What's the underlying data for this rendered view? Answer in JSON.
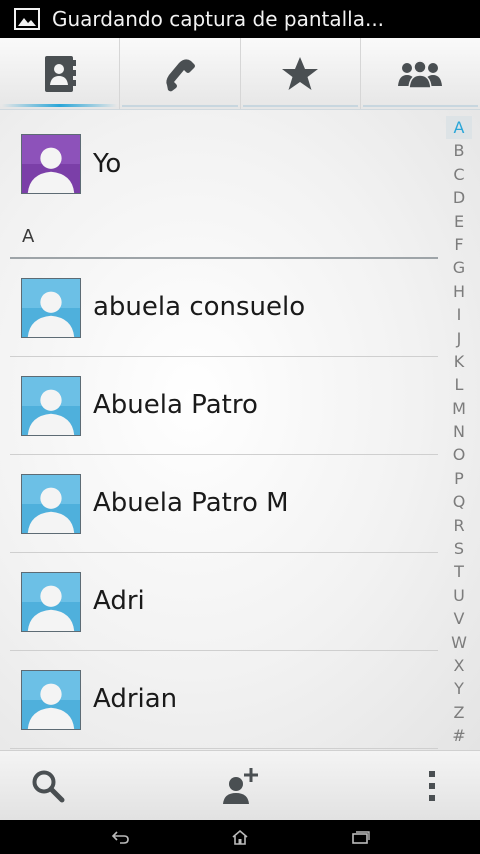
{
  "status_bar": {
    "text": "Guardando captura de pantalla..."
  },
  "tabs": [
    {
      "name": "contacts",
      "icon": "contacts-book-icon",
      "active": true
    },
    {
      "name": "phone",
      "icon": "phone-icon",
      "active": false
    },
    {
      "name": "favorites",
      "icon": "star-icon",
      "active": false
    },
    {
      "name": "groups",
      "icon": "groups-icon",
      "active": false
    }
  ],
  "me": {
    "name": "Yo",
    "avatar_color": "#7b3fa8"
  },
  "section": {
    "letter": "A"
  },
  "contacts": [
    {
      "name": "abuela consuelo"
    },
    {
      "name": "Abuela Patro"
    },
    {
      "name": "Abuela Patro M"
    },
    {
      "name": "Adri"
    },
    {
      "name": "Adrian"
    }
  ],
  "index_letters": [
    "A",
    "B",
    "C",
    "D",
    "E",
    "F",
    "G",
    "H",
    "I",
    "J",
    "K",
    "L",
    "M",
    "N",
    "O",
    "P",
    "Q",
    "R",
    "S",
    "T",
    "U",
    "V",
    "W",
    "X",
    "Y",
    "Z",
    "#"
  ],
  "index_active": "A",
  "actions": {
    "search": "search-icon",
    "add_contact": "add-contact-icon",
    "menu": "overflow-menu-icon"
  },
  "colors": {
    "accent": "#2aa6d8",
    "contact_avatar": "#4fb0dc"
  }
}
